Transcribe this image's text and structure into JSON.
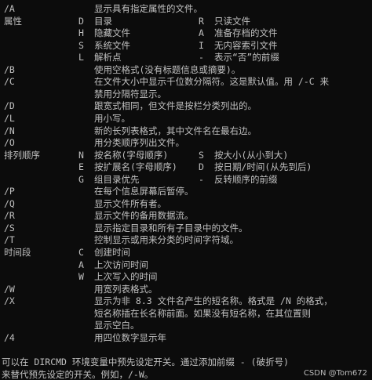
{
  "lines": [
    [
      "/A",
      "",
      "显示具有指定属性的文件。",
      "",
      "",
      ""
    ],
    [
      "属性",
      "D",
      "目录",
      "R",
      "只读文件",
      ""
    ],
    [
      "",
      "H",
      "隐藏文件",
      "A",
      "准备存档的文件",
      ""
    ],
    [
      "",
      "S",
      "系统文件",
      "I",
      "无内容索引文件",
      ""
    ],
    [
      "",
      "L",
      "解析点",
      "-",
      "表示“否”的前缀",
      ""
    ],
    [
      "/B",
      "",
      "使用空格式(没有标题信息或摘要)。",
      "",
      "",
      ""
    ],
    [
      "/C",
      "",
      "在文件大小中显示千位数分隔符。这是默认值。用 /-C 来",
      "",
      "",
      ""
    ],
    [
      "",
      "",
      "禁用分隔符显示。",
      "",
      "",
      ""
    ],
    [
      "/D",
      "",
      "跟宽式相同，但文件是按栏分类列出的。",
      "",
      "",
      ""
    ],
    [
      "/L",
      "",
      "用小写。",
      "",
      "",
      ""
    ],
    [
      "/N",
      "",
      "新的长列表格式，其中文件名在最右边。",
      "",
      "",
      ""
    ],
    [
      "/O",
      "",
      "用分类顺序列出文件。",
      "",
      "",
      ""
    ],
    [
      "排列顺序",
      "N",
      "按名称(字母顺序)",
      "S",
      "按大小(从小到大)",
      ""
    ],
    [
      "",
      "E",
      "按扩展名(字母顺序)",
      "D",
      "按日期/时间(从先到后)",
      ""
    ],
    [
      "",
      "G",
      "组目录优先",
      "-",
      "反转顺序的前缀",
      ""
    ],
    [
      "/P",
      "",
      "在每个信息屏幕后暂停。",
      "",
      "",
      ""
    ],
    [
      "/Q",
      "",
      "显示文件所有者。",
      "",
      "",
      ""
    ],
    [
      "/R",
      "",
      "显示文件的备用数据流。",
      "",
      "",
      ""
    ],
    [
      "/S",
      "",
      "显示指定目录和所有子目录中的文件。",
      "",
      "",
      ""
    ],
    [
      "/T",
      "",
      "控制显示或用来分类的时间字符域。",
      "",
      "",
      ""
    ],
    [
      "时间段",
      "C",
      "创建时间",
      "",
      "",
      ""
    ],
    [
      "",
      "A",
      "上次访问时间",
      "",
      "",
      ""
    ],
    [
      "",
      "W",
      "上次写入的时间",
      "",
      "",
      ""
    ],
    [
      "/W",
      "",
      "用宽列表格式。",
      "",
      "",
      ""
    ],
    [
      "/X",
      "",
      "显示为非 8.3 文件名产生的短名称。格式是 /N 的格式，",
      "",
      "",
      ""
    ],
    [
      "",
      "",
      "短名称插在长名称前面。如果没有短名称，在其位置则",
      "",
      "",
      ""
    ],
    [
      "",
      "",
      "显示空白。",
      "",
      "",
      ""
    ],
    [
      "/4",
      "",
      "用四位数字显示年",
      "",
      "",
      ""
    ],
    [
      "",
      "",
      "",
      "",
      "",
      ""
    ],
    [
      "",
      "",
      "",
      "",
      "",
      "可以在 DIRCMD 环境变量中预先设定开关。通过添加前缀 - (破折号)"
    ],
    [
      "",
      "",
      "",
      "",
      "",
      "来替代预先设定的开关。例如，/-W。"
    ]
  ],
  "watermark": "CSDN @Tom672",
  "colors": {
    "background": "#0c0c0c",
    "text": "#c0c0c0"
  }
}
